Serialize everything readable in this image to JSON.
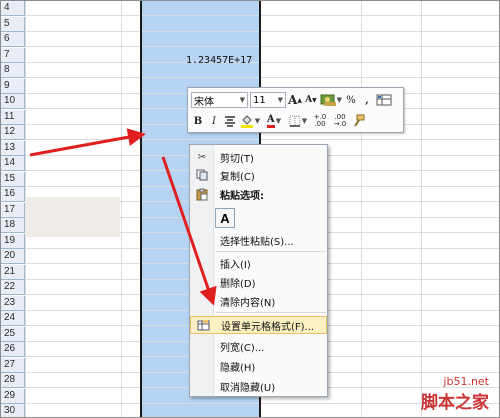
{
  "rows": [
    "4",
    "5",
    "6",
    "7",
    "8",
    "9",
    "10",
    "11",
    "12",
    "13",
    "14",
    "15",
    "16",
    "17",
    "18",
    "19",
    "20",
    "21",
    "22",
    "23",
    "24",
    "25",
    "26",
    "27",
    "28",
    "29",
    "30"
  ],
  "cell_value": "1.23457E+17",
  "mini_toolbar": {
    "font": "宋体",
    "size": "11",
    "grow_font": "A",
    "shrink_font": "A",
    "percent": "%",
    "comma": ",",
    "bold": "B",
    "italic": "I",
    "font_color": "A",
    "inc_decimal": ".0→.00",
    "dec_decimal": ".00→.0",
    "inc_decimal_l1": "+.0",
    "inc_decimal_l2": ".00",
    "dec_decimal_l1": ".00",
    "dec_decimal_l2": "→.0"
  },
  "menu": {
    "cut": "剪切(T)",
    "copy": "复制(C)",
    "paste_options": "粘贴选项:",
    "paste_a": "A",
    "paste_special": "选择性粘贴(S)...",
    "insert": "插入(I)",
    "delete": "删除(D)",
    "clear": "清除内容(N)",
    "format_cells": "设置单元格格式(F)...",
    "col_width": "列宽(C)...",
    "hide": "隐藏(H)",
    "unhide": "取消隐藏(U)"
  },
  "watermark": {
    "site": "jb51.net",
    "name": "脚本之家"
  },
  "colors": {
    "selection": "#b7d3f2",
    "arrow": "#e02020",
    "highlight": "#fdf1c4"
  }
}
